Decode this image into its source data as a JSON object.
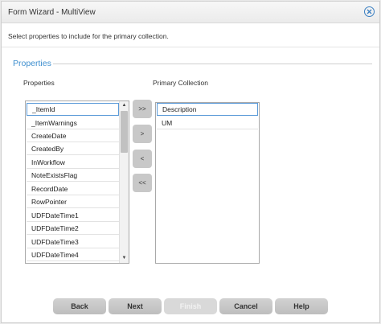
{
  "dialog": {
    "title": "Form Wizard - MultiView",
    "close_icon": "close-circle-icon",
    "instruction": "Select properties to include for the primary collection."
  },
  "section": {
    "legend": "Properties",
    "available_label": "Properties",
    "primary_label": "Primary Collection"
  },
  "available_items": [
    "_ItemId",
    "_ItemWarnings",
    "CreateDate",
    "CreatedBy",
    "InWorkflow",
    "NoteExistsFlag",
    "RecordDate",
    "RowPointer",
    "UDFDateTime1",
    "UDFDateTime2",
    "UDFDateTime3",
    "UDFDateTime4"
  ],
  "primary_items": [
    "Description",
    "UM"
  ],
  "move_buttons": {
    "add_all": ">>",
    "add": ">",
    "remove": "<",
    "remove_all": "<<"
  },
  "footer": {
    "back": "Back",
    "next": "Next",
    "finish": "Finish",
    "cancel": "Cancel",
    "help": "Help"
  },
  "colors": {
    "accent": "#3f8fcf",
    "button": "#c8c8c8",
    "selection_border": "#5a9ad8"
  }
}
